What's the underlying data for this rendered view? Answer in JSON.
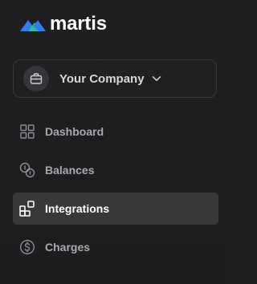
{
  "brand": {
    "name": "martis",
    "logo_icon": "mountain-logo-icon",
    "colors": {
      "blue": "#2f7df6",
      "green": "#27c281"
    }
  },
  "company_selector": {
    "label": "Your Company",
    "icon": "briefcase-icon",
    "chevron": "chevron-down-icon"
  },
  "nav": {
    "items": [
      {
        "label": "Dashboard",
        "icon": "grid-icon",
        "active": false
      },
      {
        "label": "Balances",
        "icon": "coins-icon",
        "active": false
      },
      {
        "label": "Integrations",
        "icon": "integrations-icon",
        "active": true
      },
      {
        "label": "Charges",
        "icon": "dollar-circle-icon",
        "active": false
      }
    ]
  }
}
